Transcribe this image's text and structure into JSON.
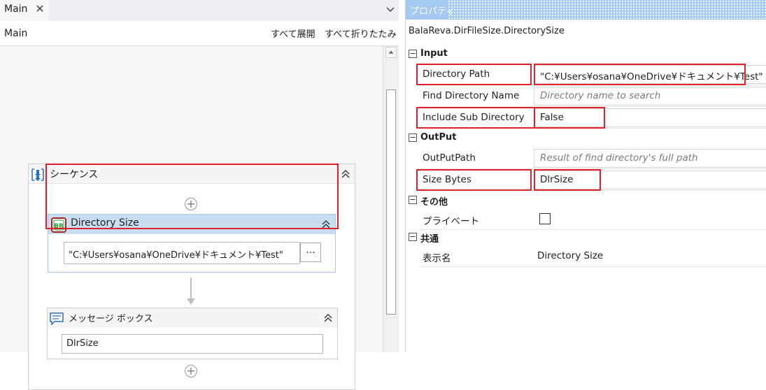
{
  "designer": {
    "tab_label": "Main",
    "breadcrumb": "Main",
    "expand_all": "すべて展開",
    "collapse_all": "すべて折りたたみ",
    "sequence_title": "シーケンス",
    "activity": {
      "title": "Directory Size",
      "path_value": "\"C:¥Users¥osana¥OneDrive¥ドキュメント¥Test\"",
      "browse_label": "..."
    },
    "message_box": {
      "title": "メッセージ ボックス",
      "value": "DlrSize"
    }
  },
  "properties": {
    "panel_title": "プロパティ",
    "type_name": "BalaReva.DirFileSize.DirectorySize",
    "categories": [
      {
        "label": "Input",
        "rows": [
          {
            "name": "Directory Path",
            "value": "\"C:¥Users¥osana¥OneDrive¥ドキュメント¥Test\""
          },
          {
            "name": "Find Directory Name",
            "placeholder": "Directory name to search"
          },
          {
            "name": "Include Sub Directory",
            "value": "False"
          }
        ]
      },
      {
        "label": "OutPut",
        "rows": [
          {
            "name": "OutPutPath",
            "placeholder": "Result of find directory's full path"
          },
          {
            "name": "Size Bytes",
            "value": "DlrSize"
          }
        ]
      },
      {
        "label": "その他",
        "rows": [
          {
            "name": "プライベート",
            "checked": false
          }
        ]
      },
      {
        "label": "共通",
        "rows": [
          {
            "name": "表示名",
            "value": "Directory Size"
          }
        ]
      }
    ]
  },
  "colors": {
    "highlight": "#e0202a",
    "activity_header": "#c8ddf0",
    "panel_title_bar": "#a6c9f0"
  }
}
